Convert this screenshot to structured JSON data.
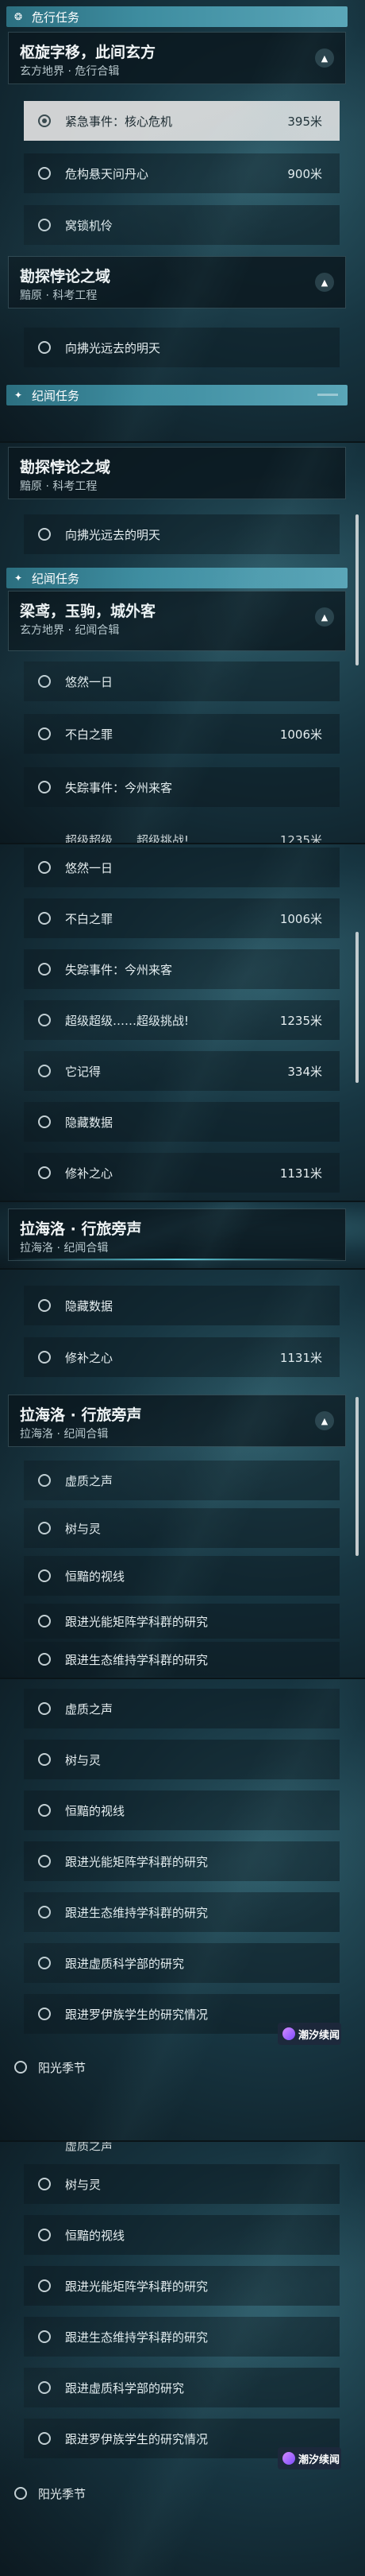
{
  "sections": {
    "danger": {
      "label": "危行任务"
    },
    "chronicle": {
      "label": "纪闻任务"
    }
  },
  "quests": {
    "xuanfang": {
      "title": "枢旋字移，此间玄方",
      "sub": "玄方地界 · 危行合辑",
      "toggle": "▲"
    },
    "tanta": {
      "title": "勘探悖论之域",
      "sub": "黯原 · 科考工程",
      "toggle": "▲"
    },
    "liangyuan": {
      "title": "梁鸢，玉驹，城外客",
      "sub": "玄方地界 · 纪闻合辑",
      "toggle": "▲"
    },
    "lahailuo": {
      "title": "拉海洛 · 行旅旁声",
      "sub": "拉海洛 · 纪闻合辑",
      "toggle": "▲"
    }
  },
  "items": {
    "emergency": {
      "label": "紧急事件：核心危机",
      "dist": "395米"
    },
    "danger2": {
      "label": "危构悬天问丹心",
      "dist": "900米"
    },
    "hidden": {
      "label": "窝锁机伶"
    },
    "light": {
      "label": "向拂光远去的明天"
    },
    "day": {
      "label": "悠然一日"
    },
    "sin": {
      "label": "不白之罪",
      "dist": "1006米"
    },
    "missing": {
      "label": "失踪事件：今州来客"
    },
    "challenge": {
      "label": "超级超级……超级挑战!",
      "dist": "1235米"
    },
    "remember": {
      "label": "它记得",
      "dist": "334米"
    },
    "hiddendata": {
      "label": "隐藏数据"
    },
    "heart": {
      "label": "修补之心",
      "dist": "1131米"
    },
    "voice": {
      "label": "虚质之声"
    },
    "tree": {
      "label": "树与灵"
    },
    "eternal": {
      "label": "恒黯的视线"
    },
    "research1": {
      "label": "跟进光能矩阵学科群的研究"
    },
    "research2": {
      "label": "跟进生态维持学科群的研究"
    },
    "research3": {
      "label": "跟进虚质科学部的研究"
    },
    "research4": {
      "label": "跟进罗伊族学生的研究情况"
    },
    "season": {
      "label": "阳光季节"
    }
  },
  "badge": {
    "text": "潮汐续闻"
  },
  "colors": {
    "accent": "#3e8da0",
    "active_row": "#e1e1e1",
    "scroll": "#f0f0f0"
  }
}
